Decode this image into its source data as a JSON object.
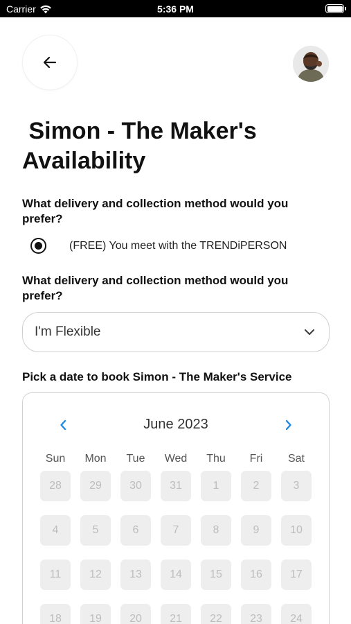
{
  "status_bar": {
    "carrier": "Carrier",
    "time": "5:36 PM"
  },
  "header": {
    "back_icon": "arrow-left-icon",
    "avatar_icon": "user-avatar"
  },
  "page": {
    "title": " Simon - The Maker's\nAvailability"
  },
  "delivery": {
    "question": "What delivery and collection method would you prefer?",
    "option_label": "(FREE) You meet with the TRENDiPERSON",
    "option_selected": true
  },
  "collection": {
    "question": "What delivery and collection method would you prefer?",
    "selected_value": "I'm Flexible",
    "icon": "chevron-down-icon"
  },
  "booking": {
    "label": "Pick a date to book Simon - The Maker's Service"
  },
  "calendar": {
    "month_label": "June 2023",
    "accent_color": "#1e88e5",
    "weekdays": [
      "Sun",
      "Mon",
      "Tue",
      "Wed",
      "Thu",
      "Fri",
      "Sat"
    ],
    "days": [
      "28",
      "29",
      "30",
      "31",
      "1",
      "2",
      "3",
      "4",
      "5",
      "6",
      "7",
      "8",
      "9",
      "10",
      "11",
      "12",
      "13",
      "14",
      "15",
      "16",
      "17",
      "18",
      "19",
      "20",
      "21",
      "22",
      "23",
      "24"
    ]
  }
}
